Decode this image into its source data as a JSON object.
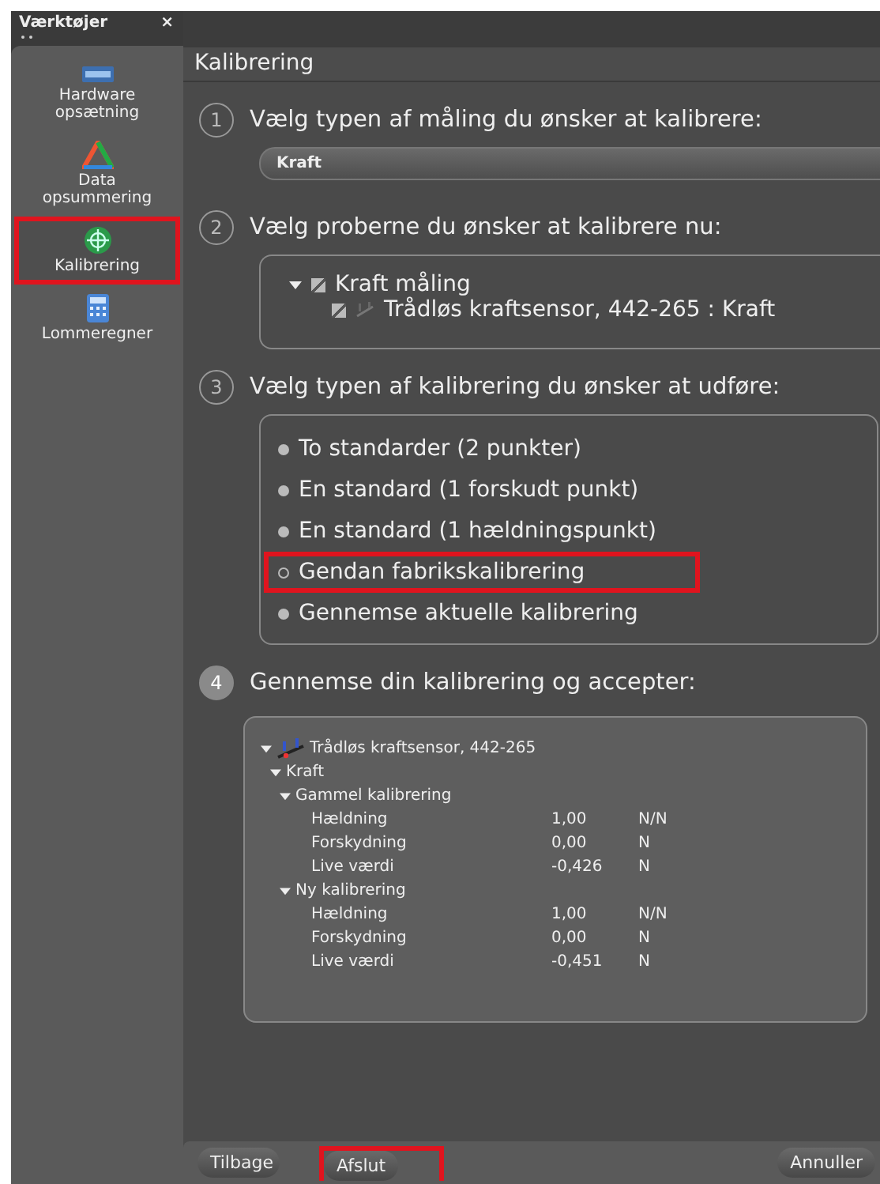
{
  "sidebar": {
    "title": "Værktøjer",
    "close": "×",
    "items": [
      {
        "kind": "hardware",
        "label": "Hardware opsætning",
        "selected": false,
        "highlighted": false
      },
      {
        "kind": "data",
        "label": "Data opsummering",
        "selected": false,
        "highlighted": false
      },
      {
        "kind": "calibration",
        "label": "Kalibrering",
        "selected": true,
        "highlighted": true
      },
      {
        "kind": "calculator",
        "label": "Lommeregner",
        "selected": false,
        "highlighted": false
      }
    ]
  },
  "page_title": "Kalibrering",
  "steps": [
    {
      "number": "1",
      "active": false,
      "title": "Vælg typen af måling du ønsker at kalibrere:",
      "kind": "dropdown",
      "value": "Kraft"
    },
    {
      "number": "2",
      "active": false,
      "title": "Vælg proberne du ønsker at kalibrere nu:",
      "kind": "probes",
      "tree": [
        {
          "label": "Kraft måling",
          "checked": true,
          "expanded": true,
          "children": [
            {
              "label": "Trådløs kraftsensor, 442-265 : Kraft",
              "checked": true
            }
          ]
        }
      ]
    },
    {
      "number": "3",
      "active": false,
      "title": "Vælg typen af kalibrering du ønsker at udføre:",
      "kind": "radios",
      "options": [
        {
          "label": "To standarder (2 punkter)",
          "selected": false,
          "highlighted": false
        },
        {
          "label": "En standard (1 forskudt punkt)",
          "selected": false,
          "highlighted": false
        },
        {
          "label": "En standard (1 hældningspunkt)",
          "selected": false,
          "highlighted": false
        },
        {
          "label": "Gendan fabrikskalibrering",
          "selected": true,
          "highlighted": true
        },
        {
          "label": "Gennemse aktuelle kalibrering",
          "selected": false,
          "highlighted": false
        }
      ]
    },
    {
      "number": "4",
      "active": true,
      "title": "Gennemse din kalibrering og accepter:",
      "kind": "review",
      "tree": [
        {
          "label": "Trådløs kraftsensor, 442-265",
          "expanded": true,
          "children": [
            {
              "label": "Kraft",
              "expanded": true,
              "children": [
                {
                  "label": "Gammel kalibrering",
                  "expanded": true,
                  "rows": [
                    {
                      "name": "Hældning",
                      "value": "1,00",
                      "unit": "N/N"
                    },
                    {
                      "name": "Forskydning",
                      "value": "0,00",
                      "unit": "N"
                    },
                    {
                      "name": "Live værdi",
                      "value": "-0,426",
                      "unit": "N"
                    }
                  ]
                },
                {
                  "label": "Ny kalibrering",
                  "expanded": true,
                  "rows": [
                    {
                      "name": "Hældning",
                      "value": "1,00",
                      "unit": "N/N"
                    },
                    {
                      "name": "Forskydning",
                      "value": "0,00",
                      "unit": "N"
                    },
                    {
                      "name": "Live værdi",
                      "value": "-0,451",
                      "unit": "N"
                    }
                  ]
                }
              ]
            }
          ]
        }
      ]
    }
  ],
  "buttons": [
    {
      "label": "Tilbage",
      "highlighted": false
    },
    {
      "label": "Afslut",
      "highlighted": true
    },
    {
      "label": "Annuller",
      "highlighted": false
    }
  ]
}
